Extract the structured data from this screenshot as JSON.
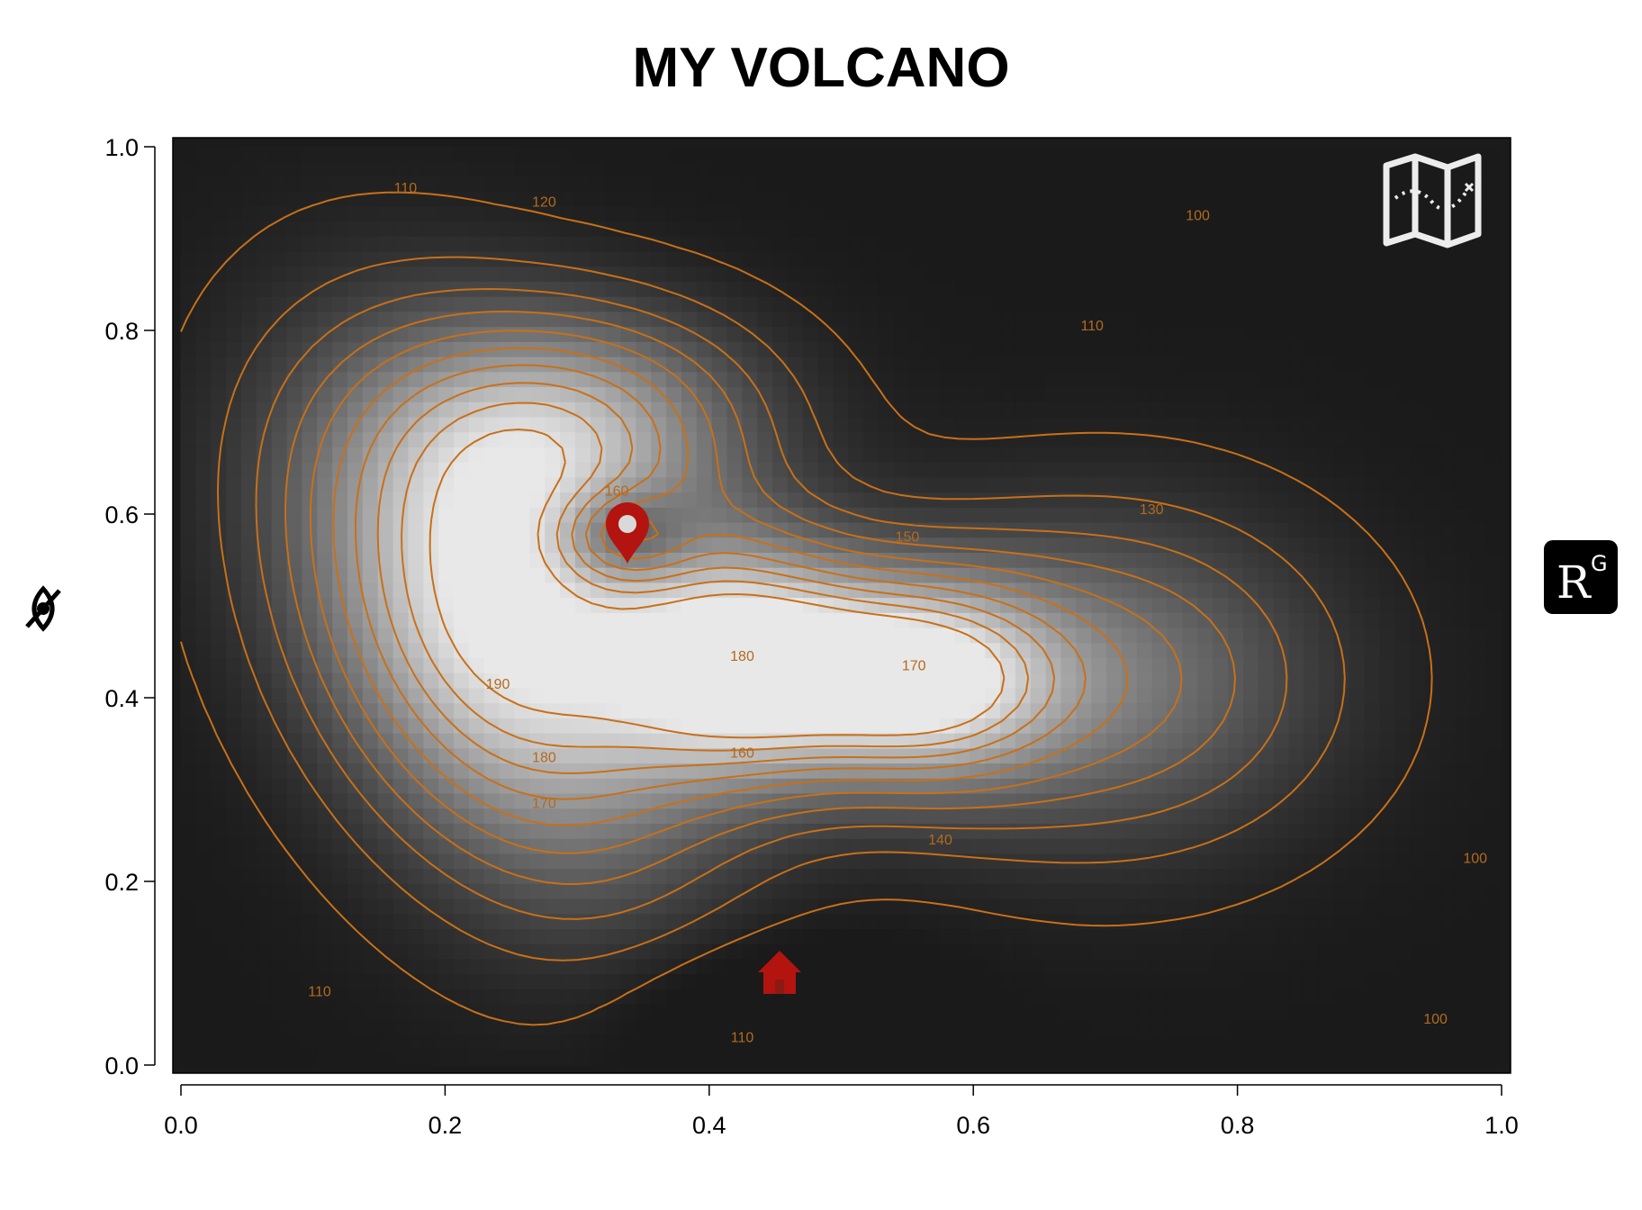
{
  "chart_data": {
    "type": "heatmap",
    "title": "MY VOLCANO",
    "xlabel": "",
    "ylabel": "",
    "xlim": [
      0,
      1
    ],
    "ylim": [
      0,
      1
    ],
    "x_ticks": [
      "0.0",
      "0.2",
      "0.4",
      "0.6",
      "0.8",
      "1.0"
    ],
    "y_ticks": [
      "0.0",
      "0.2",
      "0.4",
      "0.6",
      "0.8",
      "1.0"
    ],
    "contour_labels": [
      {
        "text": "110",
        "x": 0.17,
        "y": 0.95
      },
      {
        "text": "120",
        "x": 0.275,
        "y": 0.935
      },
      {
        "text": "110",
        "x": 0.69,
        "y": 0.8
      },
      {
        "text": "100",
        "x": 0.77,
        "y": 0.92
      },
      {
        "text": "130",
        "x": 0.735,
        "y": 0.6
      },
      {
        "text": "160",
        "x": 0.33,
        "y": 0.62
      },
      {
        "text": "150",
        "x": 0.55,
        "y": 0.57
      },
      {
        "text": "180",
        "x": 0.425,
        "y": 0.44
      },
      {
        "text": "190",
        "x": 0.24,
        "y": 0.41
      },
      {
        "text": "170",
        "x": 0.555,
        "y": 0.43
      },
      {
        "text": "180",
        "x": 0.275,
        "y": 0.33
      },
      {
        "text": "160",
        "x": 0.425,
        "y": 0.335
      },
      {
        "text": "170",
        "x": 0.275,
        "y": 0.28
      },
      {
        "text": "140",
        "x": 0.575,
        "y": 0.24
      },
      {
        "text": "100",
        "x": 0.98,
        "y": 0.22
      },
      {
        "text": "110",
        "x": 0.105,
        "y": 0.075
      },
      {
        "text": "110",
        "x": 0.425,
        "y": 0.025
      },
      {
        "text": "100",
        "x": 0.95,
        "y": 0.045
      }
    ],
    "markers": [
      {
        "name": "location-pin",
        "x": 0.335,
        "y": 0.575,
        "color": "#b3140f"
      },
      {
        "name": "home",
        "x": 0.45,
        "y": 0.09,
        "color": "#b3140f"
      }
    ],
    "colors": {
      "low": "#1a1a1a",
      "high": "#e8e8e8",
      "contour": "#c87019",
      "marker": "#b3140f"
    }
  },
  "icons": {
    "map": "map-icon",
    "ylabel": "eye-slash-icon",
    "badge": "rg-badge-icon"
  }
}
